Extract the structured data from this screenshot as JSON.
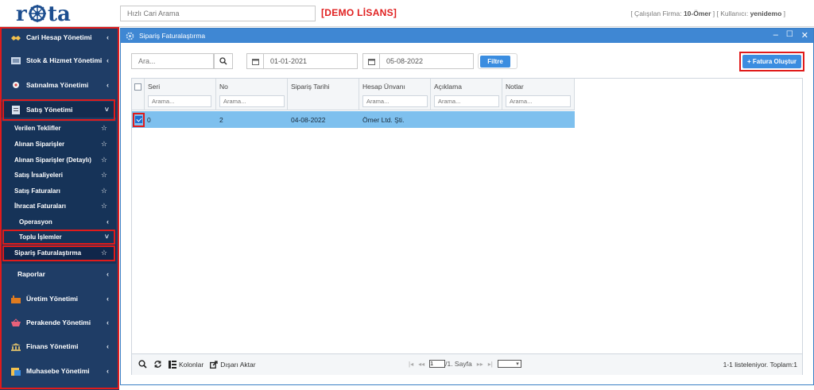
{
  "topbar": {
    "logo_text": "rota",
    "search_placeholder": "Hızlı Cari Arama",
    "demo_label": "[DEMO LİSANS]",
    "company_prefix": "[ Çalışılan Firma: ",
    "company": "10-Ömer",
    "user_prefix": " ] [ Kullanıcı: ",
    "user": "yenidemo",
    "user_suffix": " ]"
  },
  "sidebar": {
    "menu": {
      "cari": "Cari Hesap Yönetimi",
      "stok": "Stok & Hizmet Yönetimi",
      "satinalma": "Satınalma Yönetimi",
      "satis": "Satış Yönetimi",
      "raporlar": "Raporlar",
      "uretim": "Üretim Yönetimi",
      "perakende": "Perakende Yönetimi",
      "finans": "Finans Yönetimi",
      "muhasebe": "Muhasebe Yönetimi"
    },
    "sub": {
      "verilen_teklifler": "Verilen Teklifler",
      "alinan_siparisler": "Alınan Siparişler",
      "alinan_siparisler_detay": "Alınan Siparişler (Detaylı)",
      "satis_irsaliyeleri": "Satış İrsaliyeleri",
      "satis_faturalari": "Satış Faturaları",
      "ihracat_faturalari": "İhracat Faturaları",
      "operasyon": "Operasyon",
      "toplu_islemler": "Toplu İşlemler",
      "siparis_faturalastirma": "Sipariş Faturalaştırma"
    }
  },
  "window": {
    "title": "Sipariş Faturalaştırma",
    "search_placeholder": "Ara...",
    "date_from": "01-01-2021",
    "date_to": "05-08-2022",
    "filter_label": "Filtre",
    "create_label": "+ Fatura Oluştur"
  },
  "grid": {
    "columns": {
      "seri": "Seri",
      "no": "No",
      "siparis_tarihi": "Sipariş Tarihi",
      "hesap_unvani": "Hesap Ünvanı",
      "aciklama": "Açıklama",
      "notlar": "Notlar"
    },
    "filter_placeholder": "Arama...",
    "row": {
      "seri": "0",
      "no": "2",
      "siparis_tarihi": "04-08-2022",
      "hesap_unvani": "Ömer Ltd. Şti."
    },
    "footer": {
      "kolonlar": "Kolonlar",
      "disari_aktar": "Dışarı Aktar",
      "page_value": "1",
      "page_label": "/1. Sayfa",
      "summary": "1-1 listeleniyor. Toplam:1"
    }
  },
  "colors": {
    "sidebar": "#1f3d66",
    "accent": "#3b8de0",
    "highlight": "#e01b1b",
    "selected_row": "#7ec0ee"
  }
}
